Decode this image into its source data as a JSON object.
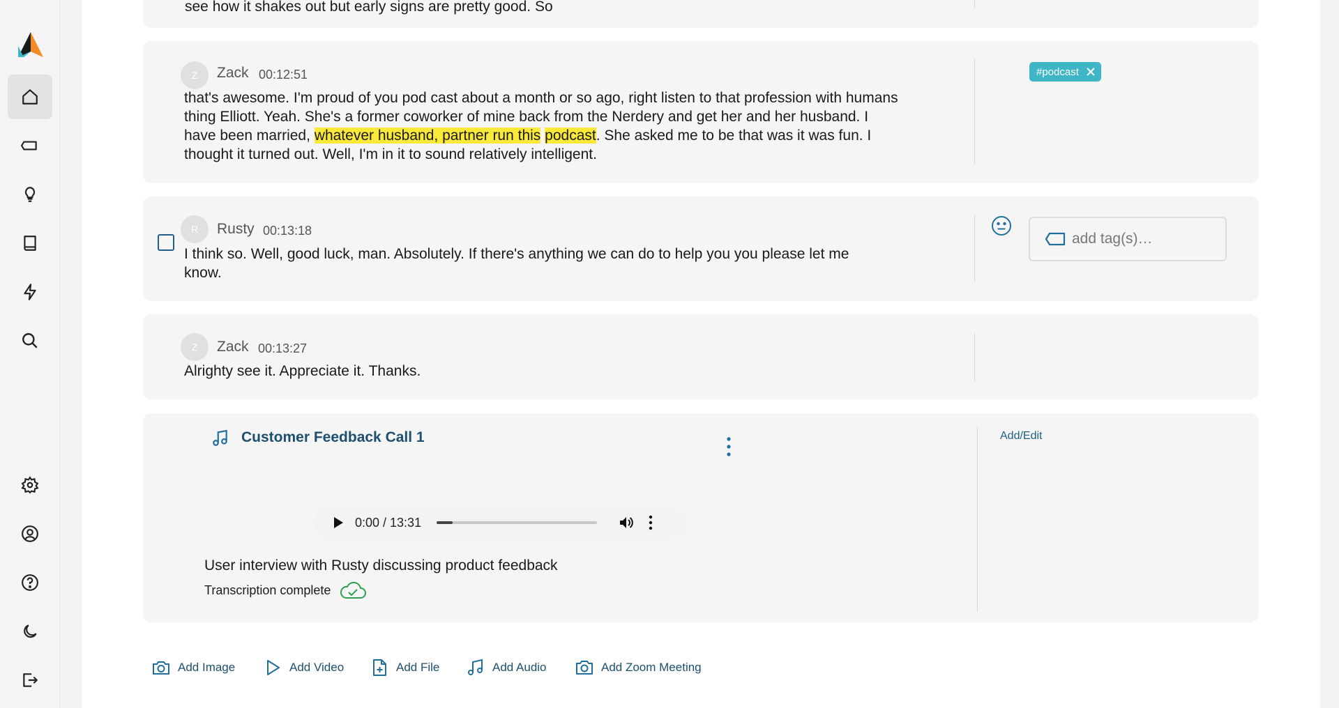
{
  "sidebar": {
    "items": [
      {
        "icon": "home-icon",
        "active": true
      },
      {
        "icon": "tag-icon"
      },
      {
        "icon": "lightbulb-icon"
      },
      {
        "icon": "book-icon"
      },
      {
        "icon": "lightning-icon"
      },
      {
        "icon": "search-icon"
      },
      {
        "icon": "gear-icon"
      },
      {
        "icon": "user-circle-icon"
      },
      {
        "icon": "help-circle-icon"
      },
      {
        "icon": "moon-icon"
      },
      {
        "icon": "logout-icon"
      }
    ]
  },
  "cards": {
    "top_partial": {
      "text": "see how it shakes out but early signs are pretty good. So"
    },
    "card1": {
      "avatar": "Z",
      "speaker": "Zack",
      "timestamp": "00:12:51",
      "text_before": "that's awesome. I'm proud of you pod cast about a month or so ago, right listen to that profession with humans thing Elliott. Yeah. She's a former coworker of mine back from the Nerdery and get her and her husband. I have been married, ",
      "highlight1": "whatever husband, partner run this",
      "text_between": " ",
      "highlight2": "podcast",
      "text_after": ". She asked me to be that was it was fun. I thought it turned out. Well, I'm in it to sound relatively intelligent.",
      "tag": "#podcast"
    },
    "card2": {
      "avatar": "R",
      "speaker": "Rusty",
      "timestamp": "00:13:18",
      "text": "I think so. Well, good luck, man. Absolutely. If there's anything we can do to help you you please let me know.",
      "tag_placeholder": "add tag(s)…"
    },
    "card3": {
      "avatar": "Z",
      "speaker": "Zack",
      "timestamp": "00:13:27",
      "text": "Alrighty see it. Appreciate it. Thanks."
    },
    "audio_card": {
      "title": "Customer Feedback Call 1",
      "player_time": "0:00 / 13:31",
      "progress": 0.1,
      "description": "User interview with Rusty discussing product feedback",
      "status": "Transcription complete",
      "add_edit": "Add/Edit"
    }
  },
  "actions": {
    "add_image": "Add Image",
    "add_video": "Add Video",
    "add_file": "Add File",
    "add_audio": "Add Audio",
    "add_zoom": "Add Zoom Meeting"
  },
  "colors": {
    "accent": "#1d4f6e",
    "tag": "#3fb6c6",
    "highlight": "#fbe93a",
    "success": "#2e9e4f"
  }
}
